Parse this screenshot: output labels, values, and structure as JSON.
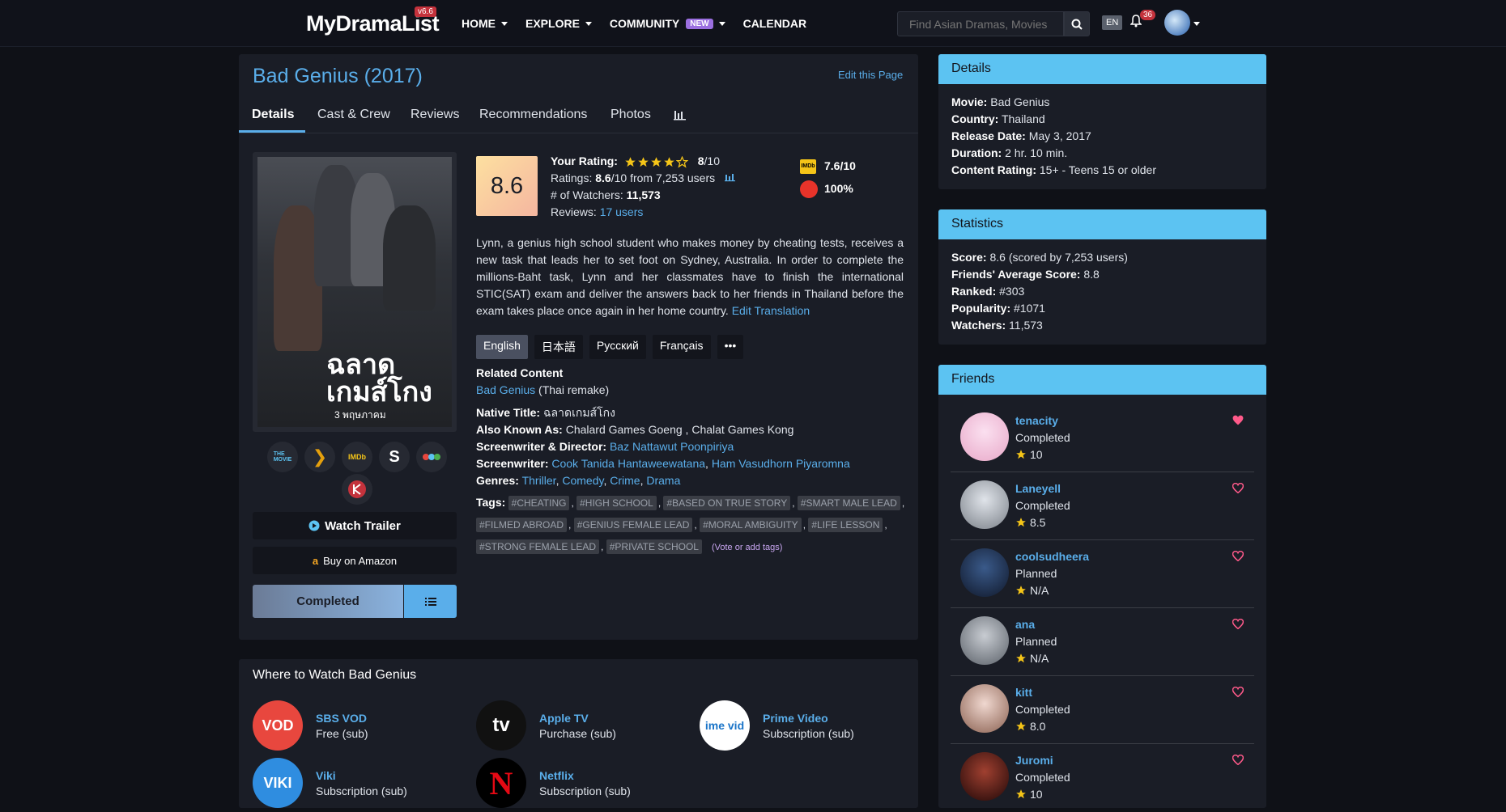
{
  "header": {
    "logo": "MyDramaList",
    "version": "v6.6",
    "nav": [
      {
        "label": "HOME"
      },
      {
        "label": "EXPLORE"
      },
      {
        "label": "COMMUNITY",
        "badge": "NEW"
      },
      {
        "label": "CALENDAR"
      }
    ],
    "search_placeholder": "Find Asian Dramas, Movies",
    "lang": "EN",
    "notifications": "36"
  },
  "page": {
    "title": "Bad Genius (2017)",
    "edit_link": "Edit this Page",
    "tabs": [
      "Details",
      "Cast & Crew",
      "Reviews",
      "Recommendations",
      "Photos"
    ],
    "poster": {
      "title_thai": "ฉลาด\nเกมส์โกง",
      "date_thai": "3 พฤษภาคม"
    },
    "watch_trailer": "Watch Trailer",
    "buy_amazon": "Buy on Amazon",
    "status_button": "Completed"
  },
  "rating": {
    "score": "8.6",
    "your_rating_label": "Your Rating:",
    "your_rating_value": "8",
    "your_rating_suffix": "/10",
    "your_rating_stars": 4,
    "ratings_label": "Ratings:",
    "ratings_value": "8.6",
    "ratings_suffix": "/10 from 7,253 users",
    "watchers_label": "# of Watchers:",
    "watchers_value": "11,573",
    "reviews_label": "Reviews:",
    "reviews_link": "17 users",
    "imdb_label": "IMDb",
    "imdb": "7.6/10",
    "tomato": "100%"
  },
  "synopsis": {
    "text": "Lynn, a genius high school student who makes money by cheating tests, receives a new task that leads her to set foot on Sydney, Australia. In order to complete the millions-Baht task, Lynn and her classmates have to finish the international STIC(SAT) exam and deliver the answers back to her friends in Thailand before the exam takes place once again in her home country.",
    "edit": "Edit Translation",
    "languages": [
      "English",
      "日本語",
      "Русский",
      "Français",
      "•••"
    ]
  },
  "related": {
    "label": "Related Content",
    "link": "Bad Genius",
    "note": " (Thai remake)"
  },
  "credits": {
    "native_label": "Native Title:",
    "native": " ฉลาดเกมส์โกง",
    "aka_label": "Also Known As:",
    "aka": " Chalard Games Goeng , Chalat Games Kong",
    "sd_label": "Screenwriter & Director:",
    "sd": "Baz Nattawut Poonpiriya",
    "sw_label": "Screenwriter:",
    "sw1": "Cook Tanida Hantaweewatana",
    "sw2": "Ham Vasudhorn Piyaromna",
    "genres_label": "Genres:",
    "genres": [
      "Thriller",
      "Comedy",
      "Crime",
      "Drama"
    ],
    "tags_label": "Tags:",
    "tags": [
      "#CHEATING",
      "#HIGH SCHOOL",
      "#BASED ON TRUE STORY",
      "#SMART MALE LEAD",
      "#FILMED ABROAD",
      "#GENIUS FEMALE LEAD",
      "#MORAL AMBIGUITY",
      "#LIFE LESSON",
      "#STRONG FEMALE LEAD",
      "#PRIVATE SCHOOL"
    ],
    "vote_tags": "(Vote or add tags)"
  },
  "where": {
    "title": "Where to Watch Bad Genius",
    "services": [
      {
        "name": "SBS VOD",
        "type": "Free (sub)",
        "logo": "VOD",
        "color": "#e8473e"
      },
      {
        "name": "Apple TV",
        "type": "Purchase (sub)",
        "logo": "tv",
        "color": "#111111"
      },
      {
        "name": "Prime Video",
        "type": "Subscription (sub)",
        "logo": "ime vid",
        "color": "#ffffff"
      },
      {
        "name": "Viki",
        "type": "Subscription (sub)",
        "logo": "VIKI",
        "color": "#2f8de0"
      },
      {
        "name": "Netflix",
        "type": "Subscription (sub)",
        "logo": "N",
        "color": "#000000"
      }
    ]
  },
  "details": {
    "head": "Details",
    "movie_label": "Movie:",
    "movie": " Bad Genius",
    "country_label": "Country:",
    "country": " Thailand",
    "release_label": "Release Date:",
    "release": " May 3, 2017",
    "duration_label": "Duration:",
    "duration": " 2 hr. 10 min.",
    "content_label": "Content Rating:",
    "content": " 15+ - Teens 15 or older"
  },
  "statistics": {
    "head": "Statistics",
    "score_label": "Score:",
    "score": " 8.6 (scored by 7,253 users)",
    "friends_label": "Friends' Average Score:",
    "friends": " 8.8",
    "ranked_label": "Ranked:",
    "ranked": " #303",
    "popularity_label": "Popularity:",
    "popularity": " #1071",
    "watchers_label": "Watchers:",
    "watchers": " 11,573"
  },
  "friends": {
    "head": "Friends",
    "list": [
      {
        "name": "tenacity",
        "status": "Completed",
        "score": "10",
        "fav": true
      },
      {
        "name": "Laneyell",
        "status": "Completed",
        "score": "8.5",
        "fav": false
      },
      {
        "name": "coolsudheera",
        "status": "Planned",
        "score": "N/A",
        "fav": false
      },
      {
        "name": "ana",
        "status": "Planned",
        "score": "N/A",
        "fav": false
      },
      {
        "name": "kitt",
        "status": "Completed",
        "score": "8.0",
        "fav": false
      },
      {
        "name": "Juromi",
        "status": "Completed",
        "score": "10",
        "fav": false
      }
    ]
  },
  "colors": {
    "accent": "#5aaeea",
    "panel_head": "#5cc3f2",
    "bg": "#0f1117",
    "card": "#1a1d26"
  }
}
